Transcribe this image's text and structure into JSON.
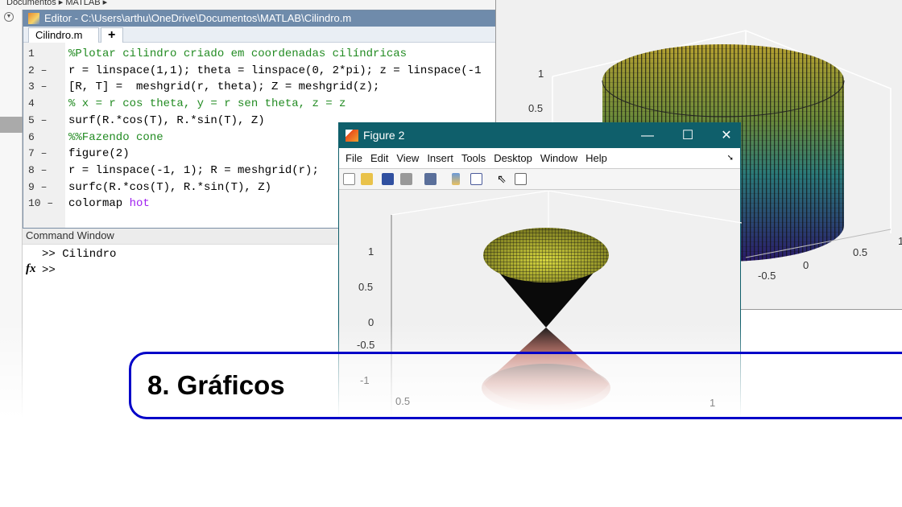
{
  "breadcrumb": "Documentos ▸ MATLAB ▸",
  "editor": {
    "title": "Editor - C:\\Users\\arthu\\OneDrive\\Documentos\\MATLAB\\Cilindro.m",
    "tab": "Cilindro.m",
    "tab_close": "✕",
    "new_tab": "+",
    "lines": [
      {
        "num": "1",
        "code": "%Plotar cilindro criado em coordenadas cilíndricas",
        "type": "comment"
      },
      {
        "num": "2 –",
        "code": "r = linspace(1,1); theta = linspace(0, 2*pi); z = linspace(-1",
        "type": "code"
      },
      {
        "num": "3 –",
        "code": "[R, T] =  meshgrid(r, theta); Z = meshgrid(z);",
        "type": "code"
      },
      {
        "num": "4",
        "code": "% x = r cos theta, y = r sen theta, z = z",
        "type": "comment"
      },
      {
        "num": "5 –",
        "code": "surf(R.*cos(T), R.*sin(T), Z)",
        "type": "code"
      },
      {
        "num": "6",
        "code": "%%Fazendo cone",
        "type": "comment"
      },
      {
        "num": "7 –",
        "code": "figure(2)",
        "type": "code"
      },
      {
        "num": "8 –",
        "code": "r = linspace(-1, 1); R = meshgrid(r);",
        "type": "code"
      },
      {
        "num": "9 –",
        "code": "surfc(R.*cos(T), R.*sin(T), Z)",
        "type": "code"
      },
      {
        "num": "10 –",
        "code": "colormap ",
        "keyword": "hot",
        "type": "code"
      }
    ]
  },
  "command_window": {
    "title": "Command Window",
    "history": ">> Cilindro",
    "prompt": ">>",
    "fx": "fx"
  },
  "figure1": {
    "ztick": [
      "1",
      "0.5"
    ],
    "xtick": [
      "-0.5",
      "0",
      "0.5",
      "1"
    ]
  },
  "figure2": {
    "title": "Figure 2",
    "controls": {
      "minimize": "—",
      "maximize": "☐",
      "close": "✕"
    },
    "menu": [
      "File",
      "Edit",
      "View",
      "Insert",
      "Tools",
      "Desktop",
      "Window",
      "Help"
    ],
    "ztick": [
      "1",
      "0.5",
      "0",
      "-0.5",
      "-1"
    ],
    "xtick": [
      "0.5",
      "1"
    ]
  },
  "chapter_title": "8. Gráficos",
  "colors": {
    "figure_titlebar": "#0f5f6b",
    "editor_titlebar": "#6f8bab",
    "chapter_border": "#0000c8"
  }
}
